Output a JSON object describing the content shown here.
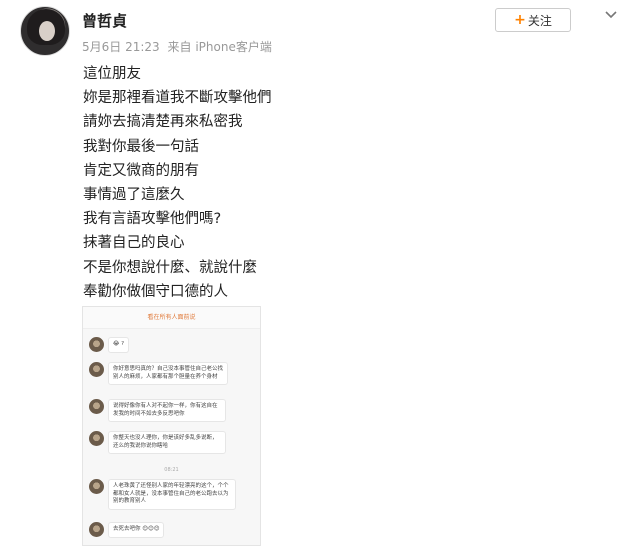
{
  "post": {
    "username": "曾哲貞",
    "date": "5月6日 21:23",
    "source": "来自 iPhone客户端",
    "follow_label": "关注",
    "lines": [
      "這位朋友",
      "妳是那裡看道我不斷攻擊他們",
      "請妳去搞清楚再來私密我",
      "我對你最後一句話",
      "肯定又微商的朋有",
      "事情過了這麼久",
      "我有言語攻擊他們嗎?",
      "抹著自己的良心",
      "不是你想說什麼、就說什麼",
      "奉勸你做個守口德的人"
    ]
  },
  "screenshot": {
    "header": "看在所有人面前说",
    "timestamp": "08:21",
    "messages": [
      "😂 ?",
      "你好意思吗真的？自己没本事管住自己老公找别人的麻烦，人家都有那个胆量在养个身材",
      "说得好像你有人对不起你一样，你有这自在发我的时间不如去多反思吧你",
      "你整天也没人理你，你是该好多乱多说断，还么的我说你说你瞎哈",
      "人老珠黄了还怪别人家的年轻漂亮的这个，个个都和女人就是，没本事管住自己的老公跑去以为别的教育别人",
      "去死去吧你 😊😊😊"
    ]
  },
  "colors": {
    "accent": "#ff8200",
    "meta": "#999999"
  },
  "icons": {
    "follow": "plus-icon",
    "menu": "chevron-down-icon"
  }
}
